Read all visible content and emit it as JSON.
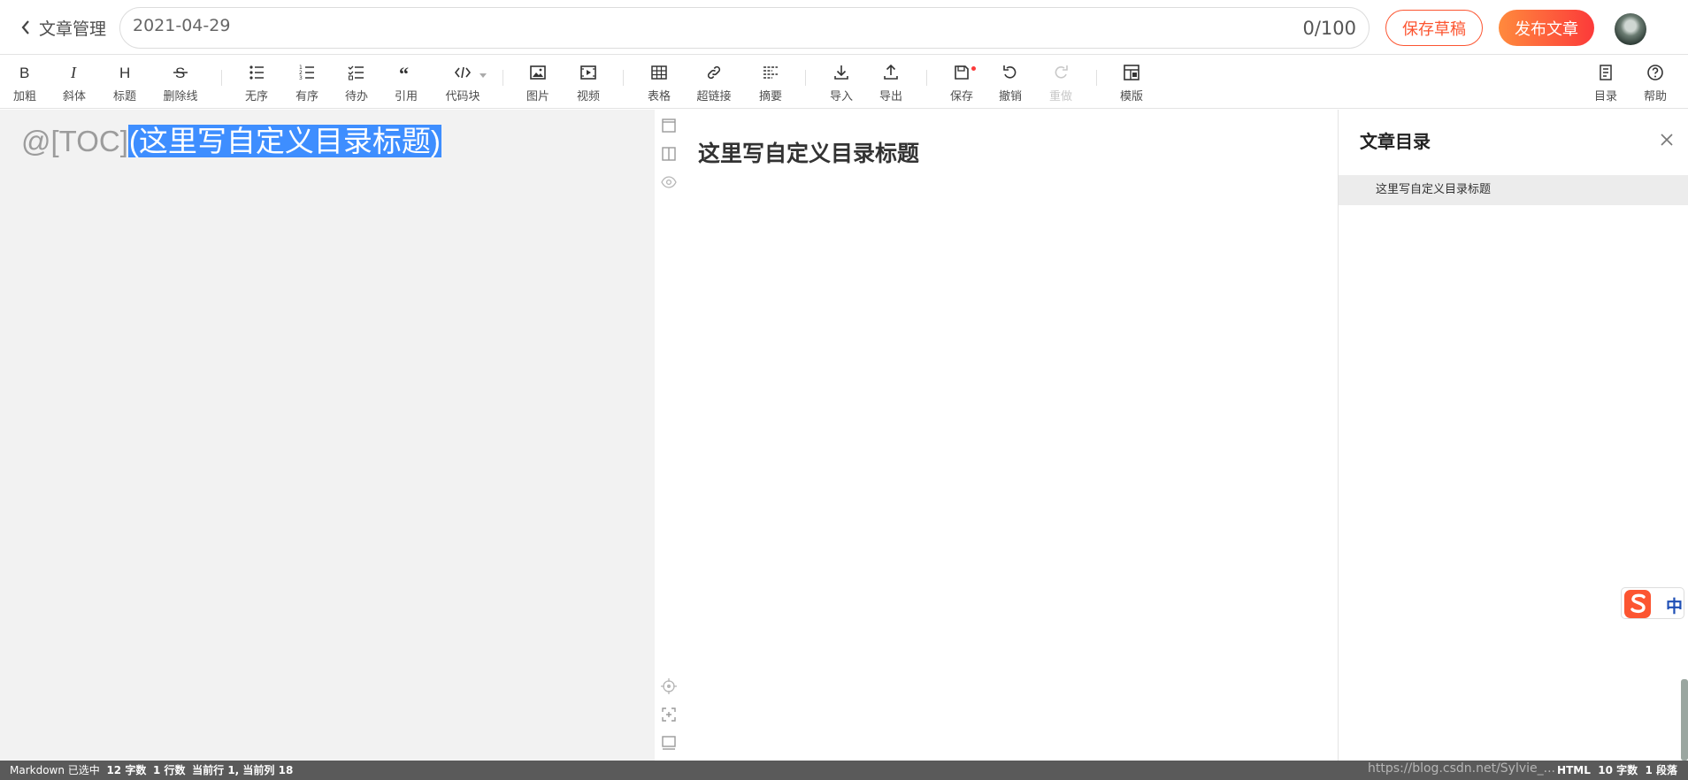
{
  "header": {
    "back_label": "文章管理",
    "title_value": "2021-04-29",
    "title_count": "0/100",
    "save_draft_label": "保存草稿",
    "publish_label": "发布文章"
  },
  "toolbar": {
    "bold": "加粗",
    "italic": "斜体",
    "heading": "标题",
    "strike": "删除线",
    "ul": "无序",
    "ol": "有序",
    "todo": "待办",
    "quote": "引用",
    "code": "代码块",
    "image": "图片",
    "video": "视频",
    "table": "表格",
    "link": "超链接",
    "summary": "摘要",
    "import": "导入",
    "export": "导出",
    "save": "保存",
    "undo": "撤销",
    "redo": "重做",
    "template": "模版",
    "toc": "目录",
    "help": "帮助"
  },
  "editor": {
    "prefix": "@[TOC]",
    "selected": "(这里写自定义目录标题)"
  },
  "preview": {
    "heading": "这里写自定义目录标题"
  },
  "toc_panel": {
    "title": "文章目录",
    "items": [
      "这里写自定义目录标题"
    ]
  },
  "ime": {
    "mode": "中"
  },
  "status": {
    "mode": "Markdown",
    "selected_label": "已选中",
    "selected_chars": "12 字数",
    "lines": "1 行数",
    "position": "当前行 1, 当前列 18",
    "html": "HTML",
    "html_chars": "10 字数",
    "paragraphs": "1 段落",
    "watermark": "https://blog.csdn.net/Sylvie_..."
  },
  "colors": {
    "accent": "#fc5531",
    "selection": "#3e8eff",
    "status_bar": "#5a5a5a"
  }
}
